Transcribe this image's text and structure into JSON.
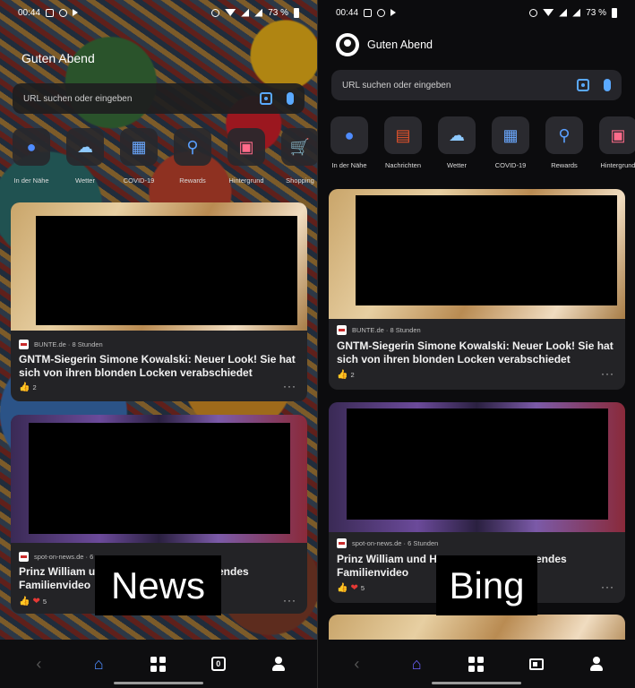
{
  "left": {
    "status": {
      "time": "00:44",
      "battery": "73 %"
    },
    "greeting": "Guten Abend",
    "search_placeholder": "URL suchen oder eingeben",
    "shortcuts": [
      {
        "label": "In der Nähe",
        "icon": "location-pin-icon"
      },
      {
        "label": "Wetter",
        "icon": "weather-icon"
      },
      {
        "label": "COVID-19",
        "icon": "covid-dashboard-icon"
      },
      {
        "label": "Rewards",
        "icon": "rewards-medal-icon"
      },
      {
        "label": "Hintergrund",
        "icon": "wallpaper-icon"
      },
      {
        "label": "Shopping",
        "icon": "shopping-cart-icon"
      }
    ],
    "cards": [
      {
        "source": "BUNTE.de · 8 Stunden",
        "title": "GNTM-Siegerin Simone Kowalski: Neuer Look! Sie hat sich von ihren blonden Locken verabschiedet",
        "reactions": "2"
      },
      {
        "source": "spot-on-news.de · 6",
        "title_line1": "Prinz William und",
        "title_line1_end": "endes",
        "title_line2": "Familienvideo",
        "reactions": "5"
      }
    ],
    "overlay_label": "News"
  },
  "right": {
    "status": {
      "time": "00:44",
      "battery": "73 %"
    },
    "greeting": "Guten Abend",
    "search_placeholder": "URL suchen oder eingeben",
    "shortcuts": [
      {
        "label": "In der Nähe",
        "icon": "location-pin-icon"
      },
      {
        "label": "Nachrichten",
        "icon": "news-icon"
      },
      {
        "label": "Wetter",
        "icon": "weather-icon"
      },
      {
        "label": "COVID-19",
        "icon": "covid-dashboard-icon"
      },
      {
        "label": "Rewards",
        "icon": "rewards-medal-icon"
      },
      {
        "label": "Hintergrund",
        "icon": "wallpaper-icon"
      }
    ],
    "cards": [
      {
        "source": "BUNTE.de · 8 Stunden",
        "title": "GNTM-Siegerin Simone Kowalski: Neuer Look! Sie hat sich von ihren blonden Locken verabschiedet",
        "reactions": "2"
      },
      {
        "source": "spot-on-news.de · 6 Stunden",
        "title_line1": "Prinz William und Her",
        "title_line1_end": "endes",
        "title_line2": "Familienvideo",
        "reactions": "5"
      }
    ],
    "overlay_label": "Bing"
  },
  "colors": {
    "accent_blue": "#4f8cff",
    "bing_accent": "#6c63ff",
    "heart": "#e53935"
  }
}
